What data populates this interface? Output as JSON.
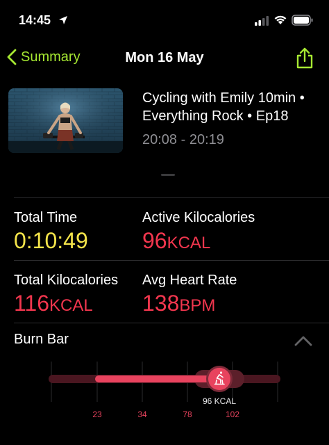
{
  "status_bar": {
    "time": "14:45",
    "icons": [
      "location-arrow-icon",
      "cellular-signal-icon",
      "wifi-icon",
      "battery-icon"
    ]
  },
  "nav": {
    "back_label": "Summary",
    "title": "Mon 16 May",
    "share_icon": "share-icon"
  },
  "workout": {
    "title": "Cycling with Emily 10min • Everything Rock • Ep18",
    "time_range": "20:08 - 20:19"
  },
  "metrics": {
    "total_time": {
      "label": "Total Time",
      "value": "0:10:49"
    },
    "active_kcal": {
      "label": "Active Kilocalories",
      "value": "96",
      "unit": "KCAL"
    },
    "total_kcal": {
      "label": "Total Kilocalories",
      "value": "116",
      "unit": "KCAL"
    },
    "avg_hr": {
      "label": "Avg Heart Rate",
      "value": "138",
      "unit": "BPM"
    }
  },
  "burn_bar": {
    "title": "Burn Bar",
    "marker_label": "96 KCAL",
    "ticks": [
      "23",
      "34",
      "78",
      "102"
    ],
    "marker_icon": "cycling-icon",
    "collapse_icon": "chevron-up-icon"
  },
  "colors": {
    "accent_green": "#a6e832",
    "time_yellow": "#f4e44a",
    "calorie_red": "#f2364e",
    "burn_pink": "#e8435e"
  }
}
